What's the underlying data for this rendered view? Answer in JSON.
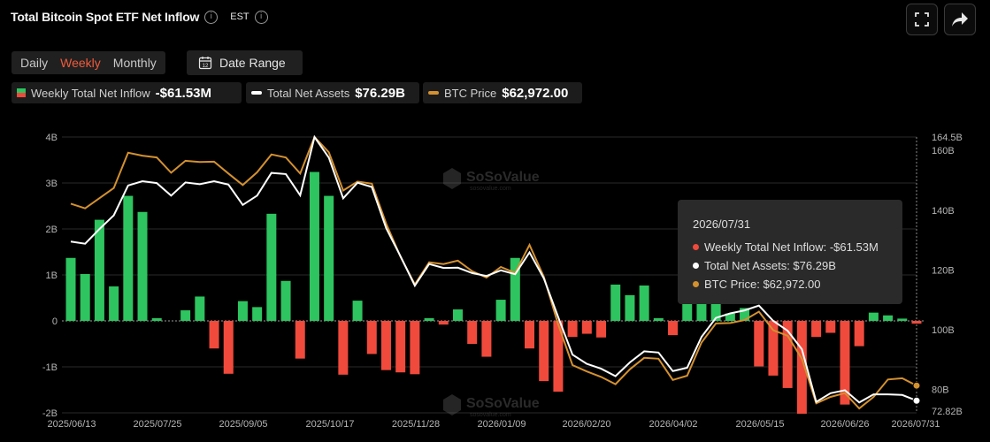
{
  "header": {
    "title": "Total Bitcoin Spot ETF Net Inflow",
    "timezone": "EST"
  },
  "controls": {
    "tabs": [
      {
        "label": "Daily",
        "active": false
      },
      {
        "label": "Weekly",
        "active": true
      },
      {
        "label": "Monthly",
        "active": false
      }
    ],
    "date_range_label": "Date Range",
    "date_range_icon_text": "12"
  },
  "legend": {
    "inflow_label": "Weekly Total Net Inflow",
    "inflow_value": "-$61.53M",
    "assets_label": "Total Net Assets",
    "assets_value": "$76.29B",
    "price_label": "BTC Price",
    "price_value": "$62,972.00"
  },
  "tooltip": {
    "date": "2026/07/31",
    "inflow": "Weekly Total Net Inflow: -$61.53M",
    "assets": "Total Net Assets: $76.29B",
    "price": "BTC Price: $62,972.00"
  },
  "watermark": {
    "brand": "SoSoValue",
    "domain": "sosovalue.com"
  },
  "colors": {
    "positive": "#2ec45f",
    "negative": "#f04a3c",
    "assets_line": "#ffffff",
    "price_line": "#d4912f",
    "accent": "#f05a3c"
  },
  "chart_data": {
    "type": "bar",
    "left_axis": {
      "ticks": [
        "4B",
        "3B",
        "2B",
        "1B",
        "0",
        "-1B",
        "-2B"
      ],
      "ylim": [
        -2,
        4
      ]
    },
    "right_axis": {
      "ticks": [
        "164.5B",
        "160B",
        "140B",
        "120B",
        "100B",
        "80B",
        "72.82B"
      ],
      "ylim": [
        72.82,
        164.5
      ]
    },
    "x_tick_labels": [
      "2025/06/13",
      "2025/07/25",
      "2025/09/05",
      "2025/10/17",
      "2025/11/28",
      "2026/01/09",
      "2026/02/20",
      "2026/04/02",
      "2026/05/15",
      "2026/06/26",
      "2026/07/31"
    ],
    "x_range": [
      "2025/06/13",
      "2026/07/31"
    ],
    "series": [
      {
        "name": "Weekly Total Net Inflow",
        "type": "bar",
        "unit": "B USD",
        "values": [
          1.37,
          1.02,
          2.2,
          0.75,
          2.72,
          2.37,
          0.06,
          0,
          0.23,
          0.53,
          -0.6,
          -1.15,
          0.43,
          0.3,
          2.33,
          0.87,
          -0.82,
          3.24,
          2.72,
          -1.17,
          0.44,
          -0.72,
          -1.07,
          -1.12,
          -1.16,
          0.06,
          -0.08,
          0.25,
          -0.5,
          -0.78,
          0.46,
          1.37,
          -0.6,
          -1.31,
          -1.54,
          -0.35,
          -0.28,
          -0.36,
          0.79,
          0.56,
          0.77,
          0.06,
          -0.31,
          0.49,
          0.4,
          0.42,
          0.16,
          0.28,
          -0.99,
          -1.19,
          -1.46,
          -2.02,
          -0.35,
          -0.26,
          -1.82,
          -0.55,
          0.18,
          0.12,
          0.05,
          -0.06
        ]
      },
      {
        "name": "Total Net Assets",
        "type": "line",
        "unit": "B USD",
        "values": [
          129.5,
          128.8,
          133.7,
          138.3,
          148.3,
          149.7,
          149.1,
          144.9,
          149.3,
          148.7,
          149.7,
          148.6,
          141.8,
          144.9,
          152.5,
          152.1,
          145.0,
          164.5,
          157.6,
          144.0,
          149.2,
          147.8,
          134.0,
          124.6,
          114.8,
          122.0,
          120.7,
          120.8,
          119.0,
          118.0,
          119.9,
          118.6,
          125.9,
          117.2,
          104.3,
          91.7,
          88.6,
          87.0,
          84.5,
          89.1,
          92.8,
          92.4,
          86.2,
          87.3,
          97.6,
          104.0,
          105.5,
          106.5,
          108.1,
          103.0,
          99.7,
          93.5,
          75.9,
          78.8,
          79.8,
          75.7,
          78.4,
          78.4,
          78.2,
          76.3
        ]
      },
      {
        "name": "BTC Price",
        "type": "line",
        "unit": "USD",
        "values": [
          105800,
          104700,
          107100,
          109500,
          117800,
          117100,
          116700,
          113100,
          115900,
          115600,
          115700,
          112900,
          110200,
          113200,
          117400,
          116700,
          112900,
          121500,
          117900,
          108900,
          111000,
          110500,
          101100,
          93300,
          86800,
          92000,
          91600,
          92400,
          89900,
          88400,
          90900,
          89500,
          96100,
          88600,
          77400,
          67800,
          66300,
          65000,
          63300,
          66800,
          69500,
          69300,
          64300,
          65300,
          73100,
          77600,
          77700,
          78400,
          80400,
          76000,
          74700,
          69300,
          58800,
          60300,
          61200,
          57600,
          60300,
          64400,
          64700,
          62972
        ]
      }
    ]
  }
}
